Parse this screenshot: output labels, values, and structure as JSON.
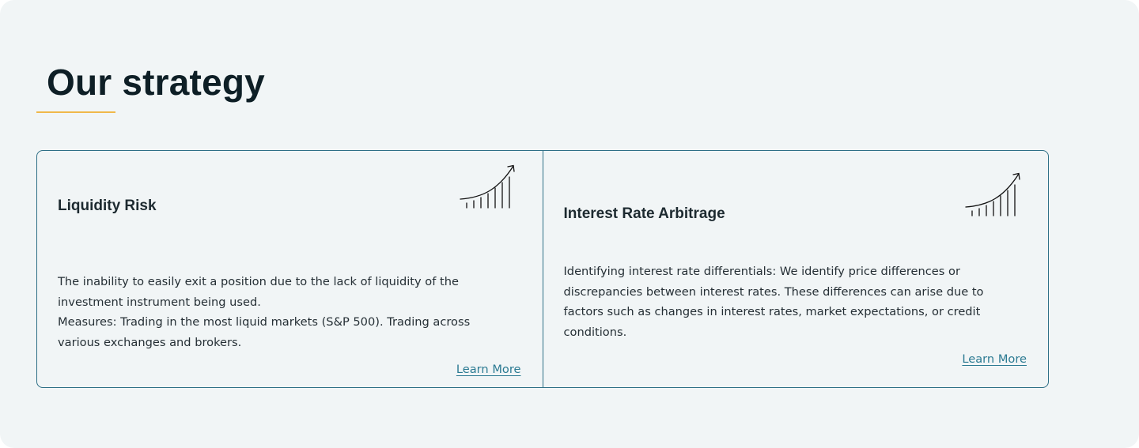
{
  "section": {
    "title": "Our strategy",
    "accent_color": "#f0b84a",
    "border_color": "#2e6f86",
    "link_color": "#2b7a92"
  },
  "cards": [
    {
      "title": "Liquidity Risk",
      "icon": "growth-chart-icon",
      "body": [
        "The inability to easily exit a position due to the lack of liquidity of the investment instrument being used.",
        "Measures: Trading in the most liquid markets (S&P 500). Trading across various exchanges and brokers."
      ],
      "link_label": "Learn More"
    },
    {
      "title": "Interest Rate Arbitrage",
      "icon": "growth-chart-icon",
      "body": [
        "Identifying interest rate differentials: We identify price differences or discrepancies between interest rates. These differences can arise due to factors such as changes in interest rates, market expectations, or credit conditions."
      ],
      "link_label": "Learn More"
    }
  ]
}
